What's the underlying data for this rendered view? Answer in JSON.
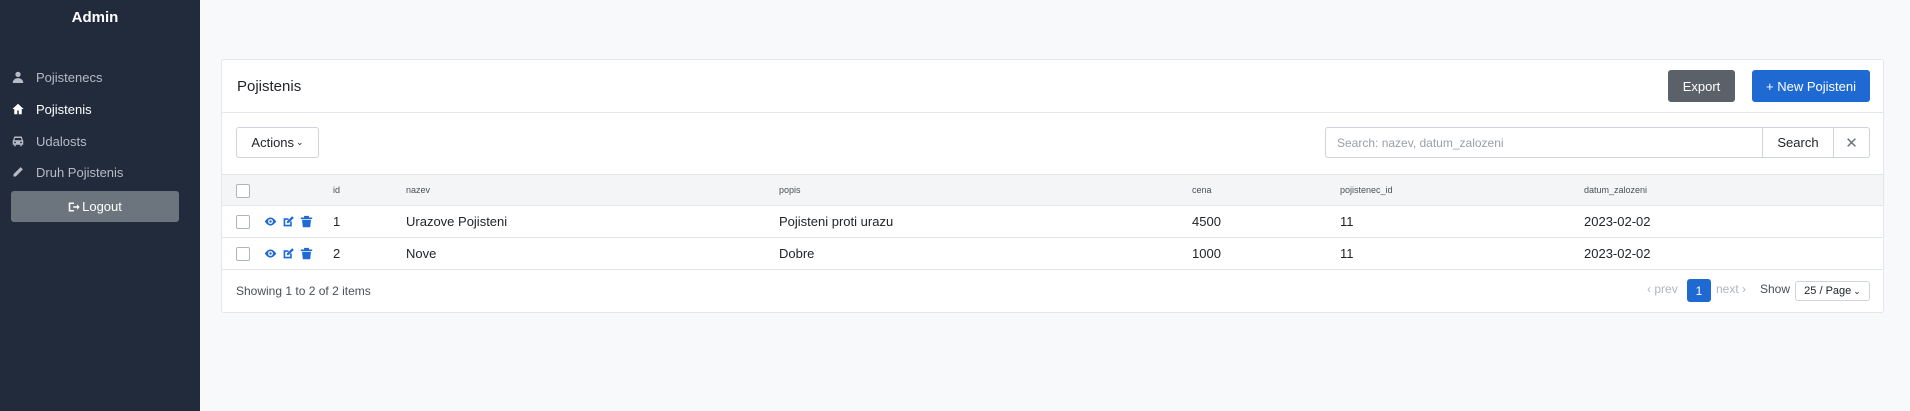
{
  "sidebar": {
    "brand": "Admin",
    "items": [
      {
        "label": "Pojistenecs",
        "icon": "user-icon",
        "active": false
      },
      {
        "label": "Pojistenis",
        "icon": "home-icon",
        "active": true
      },
      {
        "label": "Udalosts",
        "icon": "car-icon",
        "active": false
      },
      {
        "label": "Druh Pojistenis",
        "icon": "pencil-icon",
        "active": false
      }
    ],
    "logout_label": "Logout"
  },
  "card": {
    "title": "Pojistenis",
    "export_label": "Export",
    "new_label": "+ New Pojisteni"
  },
  "toolbar": {
    "actions_label": "Actions",
    "search_placeholder": "Search: nazev, datum_zalozeni",
    "search_label": "Search",
    "clear_label": "✕"
  },
  "table": {
    "columns": [
      "id",
      "nazev",
      "popis",
      "cena",
      "pojistenec_id",
      "datum_zalozeni"
    ],
    "rows": [
      {
        "id": "1",
        "nazev": "Urazove Pojisteni",
        "popis": "Pojisteni proti urazu",
        "cena": "4500",
        "pojistenec_id": "11",
        "datum_zalozeni": "2023-02-02"
      },
      {
        "id": "2",
        "nazev": "Nove",
        "popis": "Dobre",
        "cena": "1000",
        "pojistenec_id": "11",
        "datum_zalozeni": "2023-02-02"
      }
    ]
  },
  "footer": {
    "showing": "Showing 1 to 2 of 2 items",
    "prev_label": "prev",
    "current_page": "1",
    "next_label": "next",
    "show_label": "Show",
    "per_page": "25 / Page"
  },
  "colors": {
    "sidebar_bg": "#212b3b",
    "primary": "#1e6ad2",
    "secondary": "#5a6168"
  }
}
